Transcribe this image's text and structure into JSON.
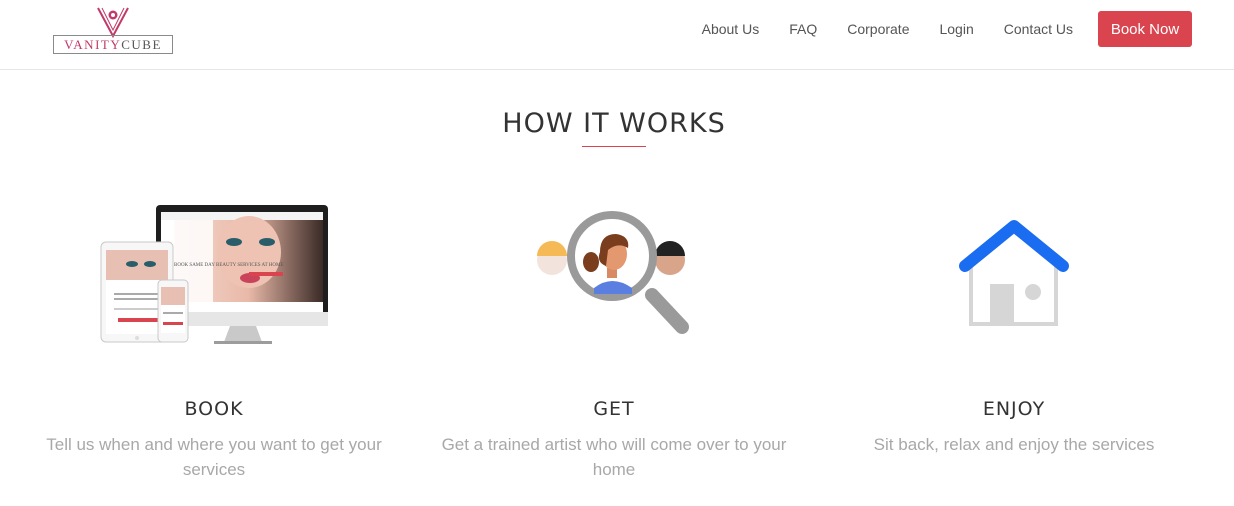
{
  "header": {
    "logo_text_part1": "VANITY",
    "logo_text_part2": "CUBE",
    "nav": [
      "About Us",
      "FAQ",
      "Corporate",
      "Login",
      "Contact Us"
    ],
    "cta": "Book Now"
  },
  "section": {
    "title": "HOW IT WORKS"
  },
  "steps": [
    {
      "icon": "devices-icon",
      "title": "BOOK",
      "desc_line1": "Tell us when and where you want to get your",
      "desc_line2": "services",
      "mock_tagline": "BOOK SAME DAY BEAUTY SERVICES AT HOME",
      "mock_phone_text": "BOOK SAME DAY BEAUTY SERVICES AT HOME"
    },
    {
      "icon": "magnifier-artist-icon",
      "title": "GET",
      "desc_line1": "Get a trained artist who will come over to your",
      "desc_line2": "home"
    },
    {
      "icon": "house-icon",
      "title": "ENJOY",
      "desc_line1": "Sit back, relax and enjoy the services",
      "desc_line2": ""
    }
  ],
  "colors": {
    "accent": "#d9444f",
    "logo_pink": "#c13a6a",
    "house_roof": "#1a6cf0",
    "house_walls": "#d6d6d6",
    "magnifier": "#9a9a9a"
  }
}
